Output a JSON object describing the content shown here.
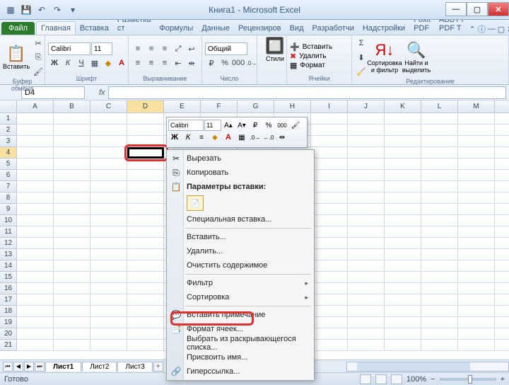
{
  "title": "Книга1 - Microsoft Excel",
  "file_tab": "Файл",
  "tabs": [
    "Главная",
    "Вставка",
    "Разметка ст",
    "Формулы",
    "Данные",
    "Рецензиров",
    "Вид",
    "Разработчи",
    "Надстройки",
    "Foxit PDF",
    "ABBYY PDF T"
  ],
  "groups": {
    "clipboard": {
      "label": "Буфер обмена",
      "paste": "Вставить"
    },
    "font": {
      "label": "Шрифт",
      "name": "Calibri",
      "size": "11"
    },
    "align": {
      "label": "Выравнивание"
    },
    "number": {
      "label": "Число",
      "format": "Общий"
    },
    "styles": {
      "label": " ",
      "btn": "Стили"
    },
    "cells": {
      "label": "Ячейки",
      "insert": "Вставить",
      "delete": "Удалить",
      "format": "Формат"
    },
    "editing": {
      "label": "Редактирование",
      "sort": "Сортировка и фильтр",
      "find": "Найти и выделить"
    }
  },
  "namebox": "D4",
  "fx_label": "fx",
  "columns": [
    "A",
    "B",
    "C",
    "D",
    "E",
    "F",
    "G",
    "H",
    "I",
    "J",
    "K",
    "L",
    "M"
  ],
  "rows": [
    "1",
    "2",
    "3",
    "4",
    "5",
    "6",
    "7",
    "8",
    "9",
    "10",
    "11",
    "12",
    "13",
    "14",
    "15",
    "16",
    "17",
    "18",
    "19",
    "20",
    "21"
  ],
  "selected_col": "D",
  "selected_row": "4",
  "minitb": {
    "font": "Calibri",
    "size": "11"
  },
  "ctx": {
    "cut": "Вырезать",
    "copy": "Копировать",
    "paste_hdr": "Параметры вставки:",
    "paste_special": "Специальная вставка...",
    "insert": "Вставить...",
    "delete": "Удалить...",
    "clear": "Очистить содержимое",
    "filter": "Фильтр",
    "sort": "Сортировка",
    "comment": "Вставить примечание",
    "format": "Формат ячеек...",
    "dropdown": "Выбрать из раскрывающегося списка...",
    "name": "Присвоить имя...",
    "hyperlink": "Гиперссылка..."
  },
  "sheets": [
    "Лист1",
    "Лист2",
    "Лист3"
  ],
  "status": "Готово",
  "zoom": "100%"
}
